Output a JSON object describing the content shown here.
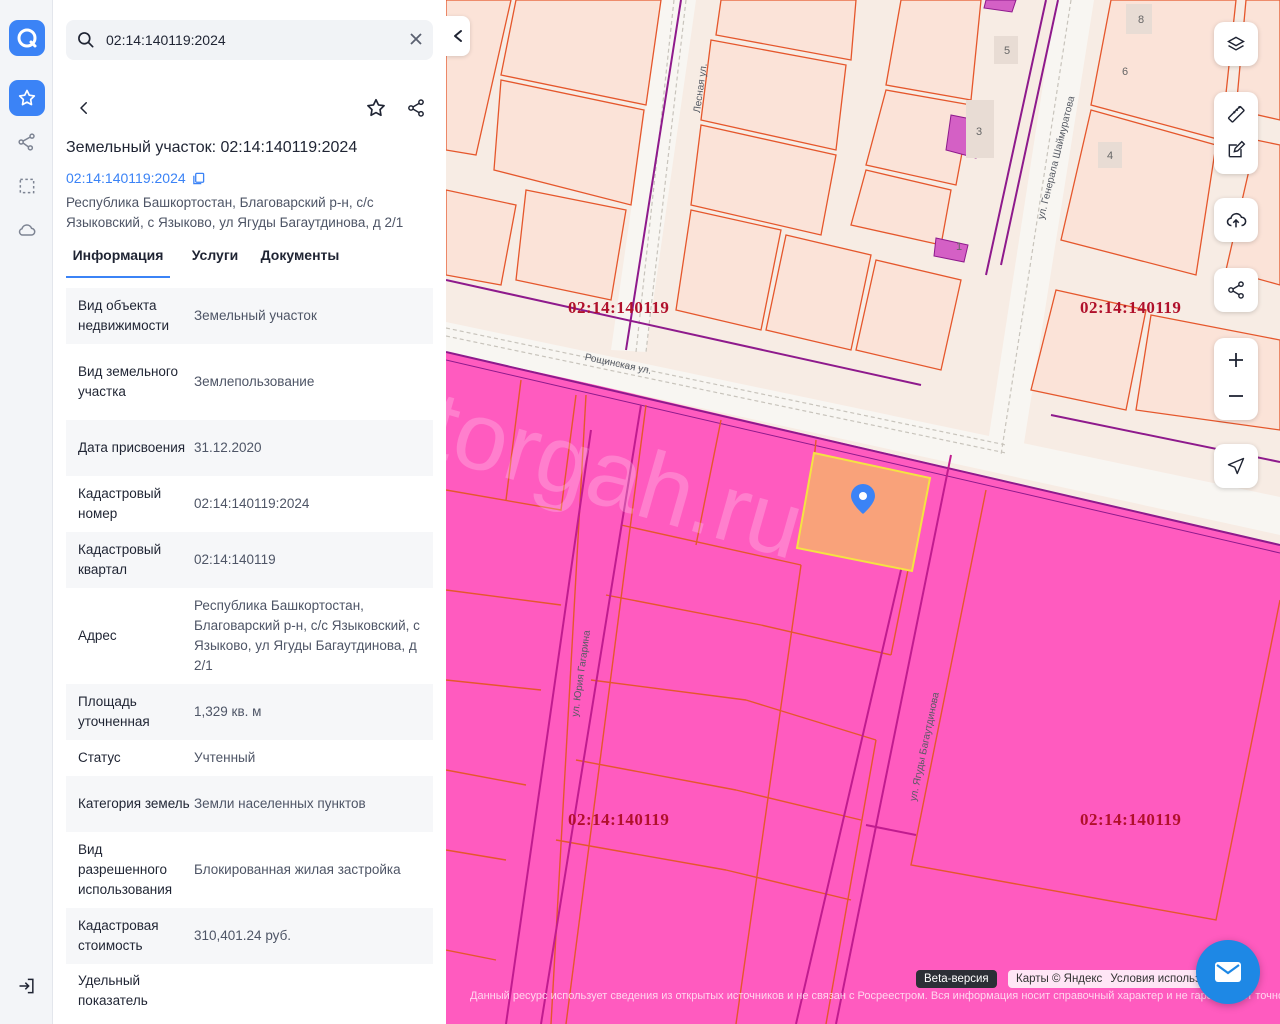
{
  "search": {
    "value": "02:14:140119:2024"
  },
  "object": {
    "title": "Земельный участок: 02:14:140119:2024",
    "cad_link": "02:14:140119:2024",
    "address": "Республика Башкортостан, Благоварский р-н, с/с Языковский, с Языково, ул Ягуды Багаутдинова, д 2/1"
  },
  "tabs": [
    {
      "label": "Информация",
      "active": true
    },
    {
      "label": "Услуги",
      "active": false
    },
    {
      "label": "Документы",
      "active": false
    }
  ],
  "info": [
    {
      "label": "Вид объекта недвижимости",
      "value": "Земельный участок"
    },
    {
      "label": "Вид земельного участка",
      "value": "Землепользование"
    },
    {
      "label": "Дата присвоения",
      "value": "31.12.2020"
    },
    {
      "label": "Кадастровый номер",
      "value": "02:14:140119:2024"
    },
    {
      "label": "Кадастровый квартал",
      "value": "02:14:140119"
    },
    {
      "label": "Адрес",
      "value": "Республика Башкортостан, Благоварский р-н, с/с Языковский, с Языково, ул Ягуды Багаутдинова, д 2/1"
    },
    {
      "label": "Площадь уточненная",
      "value": "1,329 кв. м"
    },
    {
      "label": "Статус",
      "value": "Учтенный"
    },
    {
      "label": "Категория земель",
      "value": "Земли населенных пунктов"
    },
    {
      "label": "Вид разрешенного использования",
      "value": "Блокированная жилая застройка"
    },
    {
      "label": "Кадастровая стоимость",
      "value": "310,401.24 руб."
    },
    {
      "label": "Удельный показатель",
      "value": ""
    }
  ],
  "map": {
    "quarter_labels": [
      "02:14:140119",
      "02:14:140119",
      "02:14:140119",
      "02:14:140119"
    ],
    "streets": {
      "lesnaya": "Лесная ул.",
      "roschinskaya": "Рощинская ул.",
      "shaymuratova": "ул. Генерала Шаймуратова",
      "gagarina": "ул. Юрия Гагарина",
      "bagautdinova": "ул. Ягуды Багаутдинова"
    },
    "house_numbers": [
      "8",
      "5",
      "6",
      "3",
      "4",
      "1"
    ],
    "watermark": "torgah.ru",
    "beta": "Beta-версия",
    "copyright": "Карты © Яндекс",
    "terms": "Условия использования",
    "disclaimer": "Данный ресурс использует сведения из открытых источников и не связан с Росреестром. Вся информация носит справочный характер и не гарантирует точность и не имеет юридической силы. За официальными сведениями обращайтесь в Росреестр."
  },
  "colors": {
    "accent": "#3b83f6",
    "parcel_border": "#e5572c",
    "quarter_fill": "#ff5bbf",
    "selected_fill": "#f9a27a",
    "selected_border": "#f5e342",
    "quarter_label": "#b0102b",
    "boundary_purple": "#8e1a8c"
  },
  "icons": {
    "logo": "app-logo-icon",
    "favorites": "star-icon",
    "route": "route-icon",
    "selection": "dashed-square-icon",
    "cloud": "cloud-icon",
    "logout": "logout-icon",
    "search": "search-icon",
    "clear": "close-icon",
    "back": "chevron-left-icon",
    "share": "share-icon",
    "copy": "copy-icon",
    "layers": "layers-icon",
    "ruler": "ruler-icon",
    "edit": "edit-icon",
    "upload": "cloud-upload-icon",
    "zoom_in": "plus-icon",
    "zoom_out": "minus-icon",
    "locate": "navigation-arrow-icon",
    "mail": "mail-icon",
    "marker": "map-pin-icon"
  }
}
